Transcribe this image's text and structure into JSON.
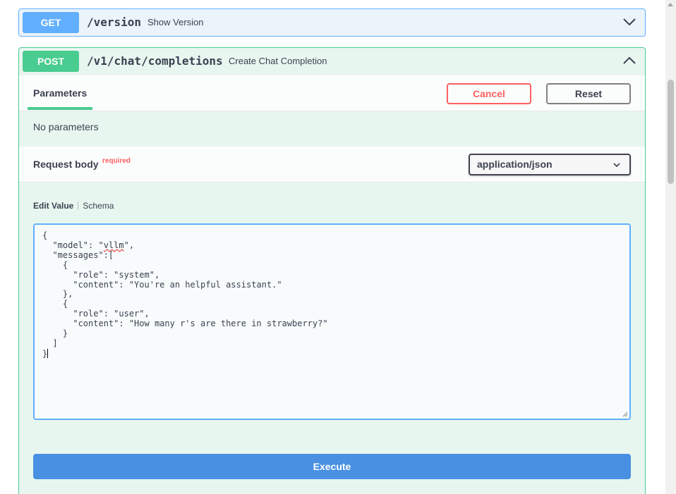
{
  "get_operation": {
    "method": "GET",
    "path": "/version",
    "summary": "Show Version",
    "toggle_icon": "chevron-down-icon"
  },
  "post_operation": {
    "method": "POST",
    "path": "/v1/chat/completions",
    "summary": "Create Chat Completion",
    "toggle_icon": "chevron-up-icon",
    "parameters_tab": "Parameters",
    "cancel_label": "Cancel",
    "reset_label": "Reset",
    "no_parameters_text": "No parameters",
    "request_body_title": "Request body",
    "required_label": "required",
    "content_type": "application/json",
    "edit_value_tab": "Edit Value",
    "schema_tab": "Schema",
    "execute_label": "Execute",
    "editor_lines": [
      "{",
      "  \"model\": \"vllm\",",
      "  \"messages\":[",
      "    {",
      "      \"role\": \"system\",",
      "      \"content\": \"You're an helpful assistant.\"",
      "    },",
      "    {",
      "      \"role\": \"user\",",
      "      \"content\": \"How many r's are there in strawberry?\"",
      "    }",
      "  ]",
      "}"
    ]
  },
  "colors": {
    "get": "#61affe",
    "post": "#49cc90",
    "cancel": "#ff6060",
    "execute": "#4990e2"
  }
}
